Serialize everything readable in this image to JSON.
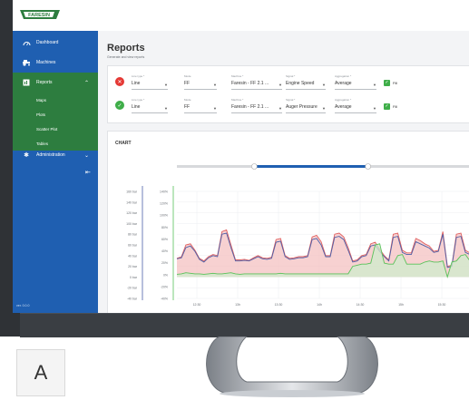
{
  "app": {
    "logo_text": "FARESIN"
  },
  "sidebar": {
    "items": [
      {
        "label": "Dashboard",
        "icon": "gauge-icon"
      },
      {
        "label": "Machines",
        "icon": "tractor-icon"
      },
      {
        "label": "Reports",
        "icon": "reports-icon"
      }
    ],
    "sub_items": [
      "Maps",
      "Plots",
      "Scatter Plot",
      "Tables"
    ],
    "admin_label": "Administration",
    "collapse_icon": "collapse-icon",
    "version": "ver. 0.0.0"
  },
  "page": {
    "title": "Reports",
    "subtitle": "Generate and view reports"
  },
  "filters": {
    "rows": [
      {
        "status": "error",
        "line_type_label": "Line type *",
        "line_type": "Line",
        "mode_label": "Mode",
        "mode": "FF",
        "machine_label": "Machine *",
        "machine": "Faresin - FF 2.1 ...",
        "signal_label": "Signal *",
        "signal": "Engine Speed",
        "aggregation_label": "Aggregation *",
        "aggregation": "Average",
        "fill_label": "Fill"
      },
      {
        "status": "ok",
        "line_type_label": "Line type *",
        "line_type": "Line",
        "mode_label": "Mode",
        "mode": "FF",
        "machine_label": "Machine *",
        "machine": "Faresin - FF 2.1 ...",
        "signal_label": "Signal *",
        "signal": "Auger Pressure",
        "aggregation_label": "Aggregation *",
        "aggregation": "Average",
        "fill_label": "Fill"
      }
    ],
    "colors": {
      "error": "#e53935",
      "ok": "#3fae49"
    }
  },
  "chart_panel": {
    "title": "CHART"
  },
  "chart_data": {
    "type": "line",
    "left_axis_ticks": [
      "160 bar",
      "140 bar",
      "120 bar",
      "100 bar",
      "80 bar",
      "60 bar",
      "40 bar",
      "20 bar",
      "0 bar",
      "-20 bar",
      "-40 bar"
    ],
    "right_axis_ticks": [
      "140%",
      "120%",
      "100%",
      "80%",
      "60%",
      "40%",
      "20%",
      "0%",
      "-20%",
      "-40%"
    ],
    "x_ticks": [
      "12:30",
      "13h",
      "13:30",
      "14h",
      "14:30",
      "15h",
      "15:30"
    ],
    "series": [
      {
        "color": "#e06060",
        "fill": "#f4c2c2",
        "values": [
          35,
          38,
          60,
          62,
          50,
          35,
          30,
          38,
          42,
          40,
          85,
          88,
          60,
          32,
          32,
          33,
          31,
          36,
          40,
          36,
          35,
          37,
          70,
          72,
          40,
          35,
          36,
          38,
          38,
          40,
          75,
          78,
          66,
          40,
          40,
          80,
          82,
          75,
          55,
          30,
          32,
          40,
          42,
          62,
          65,
          52,
          40,
          32,
          80,
          82,
          50,
          45,
          45,
          72,
          68,
          62,
          58,
          48,
          50,
          85,
          20,
          22,
          80,
          82,
          50,
          45
        ]
      },
      {
        "color": "#4c5fa8",
        "fill": "none",
        "values": [
          34,
          36,
          55,
          58,
          48,
          33,
          28,
          36,
          40,
          38,
          80,
          82,
          55,
          30,
          30,
          31,
          30,
          34,
          38,
          34,
          33,
          35,
          65,
          67,
          38,
          33,
          34,
          36,
          36,
          38,
          70,
          72,
          60,
          38,
          38,
          74,
          76,
          70,
          50,
          28,
          30,
          38,
          40,
          58,
          60,
          48,
          38,
          30,
          74,
          76,
          46,
          42,
          42,
          66,
          62,
          58,
          54,
          46,
          48,
          80,
          18,
          20,
          74,
          76,
          46,
          42
        ]
      },
      {
        "color": "#59c25a",
        "fill": "#cfeccc",
        "values": [
          5,
          6,
          8,
          7,
          6,
          6,
          5,
          6,
          7,
          6,
          6,
          7,
          8,
          6,
          5,
          6,
          6,
          6,
          6,
          6,
          6,
          6,
          6,
          7,
          6,
          6,
          6,
          6,
          6,
          6,
          6,
          6,
          6,
          6,
          6,
          6,
          6,
          6,
          6,
          20,
          22,
          24,
          24,
          26,
          60,
          62,
          26,
          24,
          24,
          40,
          42,
          24,
          24,
          24,
          24,
          28,
          30,
          28,
          28,
          30,
          0,
          28,
          30,
          40,
          42,
          30
        ]
      }
    ],
    "y_range": [
      -40,
      160
    ],
    "range_slider": {
      "start": 0.45,
      "end": 0.9
    }
  }
}
